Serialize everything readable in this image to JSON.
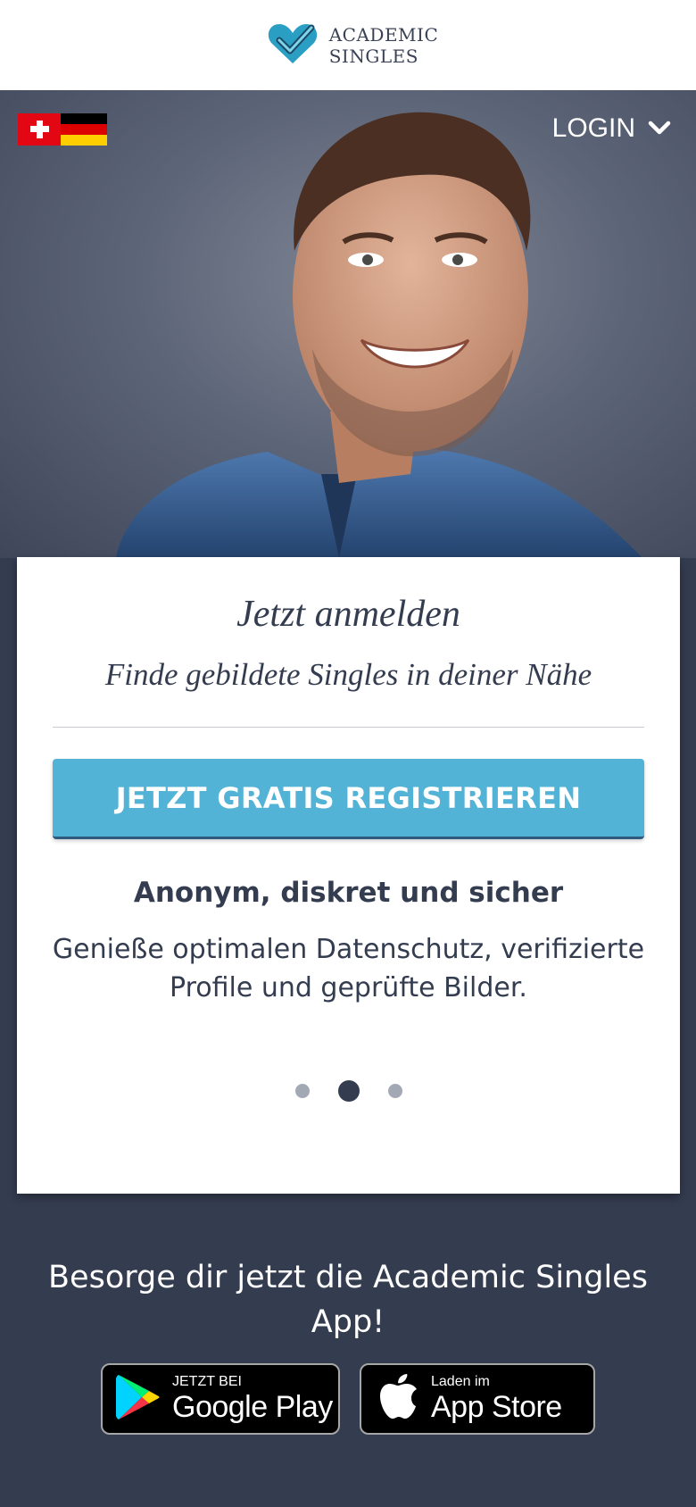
{
  "header": {
    "logo_line1": "ACADEMIC",
    "logo_line2": "SINGLES",
    "icon": "heart-check-icon"
  },
  "hero": {
    "flags": [
      "switzerland-flag",
      "germany-flag"
    ],
    "login_label": "LOGIN",
    "login_icon": "chevron-down-icon"
  },
  "card": {
    "title": "Jetzt anmelden",
    "subtitle": "Finde gebildete Singles in deiner Nähe",
    "cta_label": "JETZT GRATIS REGISTRIEREN",
    "feature_title": "Anonym, diskret und sicher",
    "feature_text": "Genieße optimalen Datenschutz, verifizierte Profile und geprüfte Bilder.",
    "carousel_active_index": 1,
    "carousel_count": 3
  },
  "promo": {
    "text": "Besorge dir jetzt die Academic Singles App!"
  },
  "stores": {
    "google_small": "JETZT BEI",
    "google_big": "Google Play",
    "apple_small": "Laden im",
    "apple_big": "App Store"
  },
  "colors": {
    "accent": "#52b3d6",
    "dark": "#343c50",
    "logo_teal": "#2a9fc3"
  }
}
